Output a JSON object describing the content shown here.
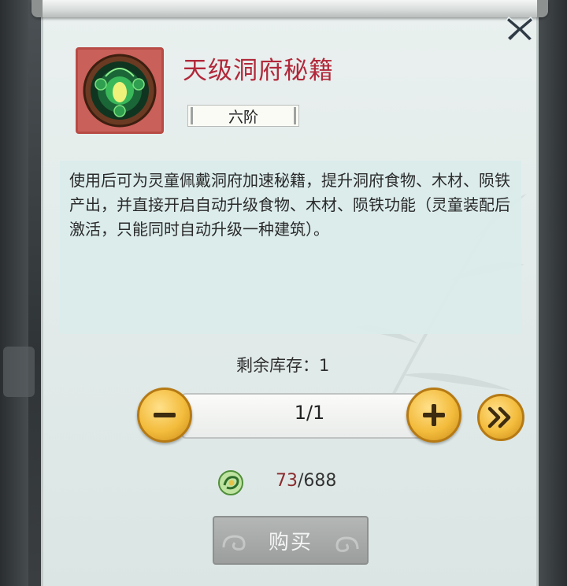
{
  "item": {
    "name": "天级洞府秘籍",
    "grade": "六阶",
    "icon": "green-orb-icon",
    "description": "使用后可为灵童佩戴洞府加速秘籍，提升洞府食物、木材、陨铁产出，并直接开启自动升级食物、木材、陨铁功能（灵童装配后激活，只能同时自动升级一种建筑）。"
  },
  "stock": {
    "text": "剩余库存：1"
  },
  "quantity": {
    "value": "1/1",
    "minus_icon": "minus-icon",
    "plus_icon": "plus-icon",
    "max_icon": "double-chevron-right-icon"
  },
  "price": {
    "owned": "73",
    "separator_cost": "/688",
    "currency_icon": "jade-coin-icon"
  },
  "buy_button": {
    "label": "购买"
  },
  "close_icon": "close-icon",
  "colors": {
    "item_name": "#b2283a",
    "owned_amount": "#8a2b2e",
    "button_gold": "#f3bc3c",
    "buy_disabled": "#a6a9a8"
  }
}
